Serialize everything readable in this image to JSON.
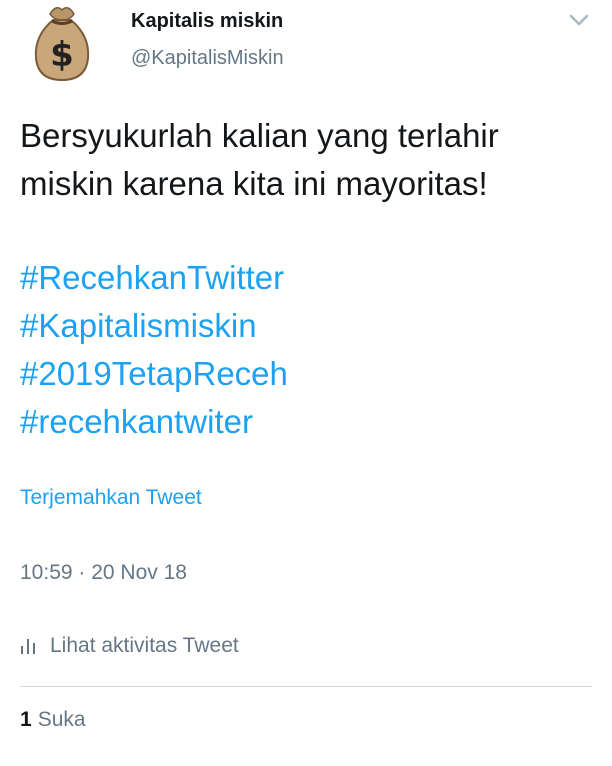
{
  "author": {
    "name": "Kapitalis miskin",
    "handle": "@KapitalisMiskin",
    "avatar_icon": "money-bag-icon"
  },
  "menu": {
    "icon": "chevron-down-icon"
  },
  "tweet": {
    "text_lines": [
      "Bersyukurlah kalian yang terlahir",
      "miskin karena kita ini mayoritas!"
    ],
    "hashtags": [
      "#RecehkanTwitter",
      "#Kapitalismiskin",
      "#2019TetapReceh",
      "#recehkantwiter"
    ],
    "translate_label": "Terjemahkan Tweet",
    "timestamp": "10:59 · 20 Nov 18"
  },
  "activity": {
    "icon": "bar-chart-icon",
    "label": "Lihat aktivitas Tweet"
  },
  "stats": {
    "likes_count": "1",
    "likes_label": "Suka"
  },
  "colors": {
    "link": "#1da1f2",
    "secondary_text": "#657786",
    "primary_text": "#14171a",
    "divider": "#cfd6dc",
    "money_bag": "#c9a77a"
  }
}
